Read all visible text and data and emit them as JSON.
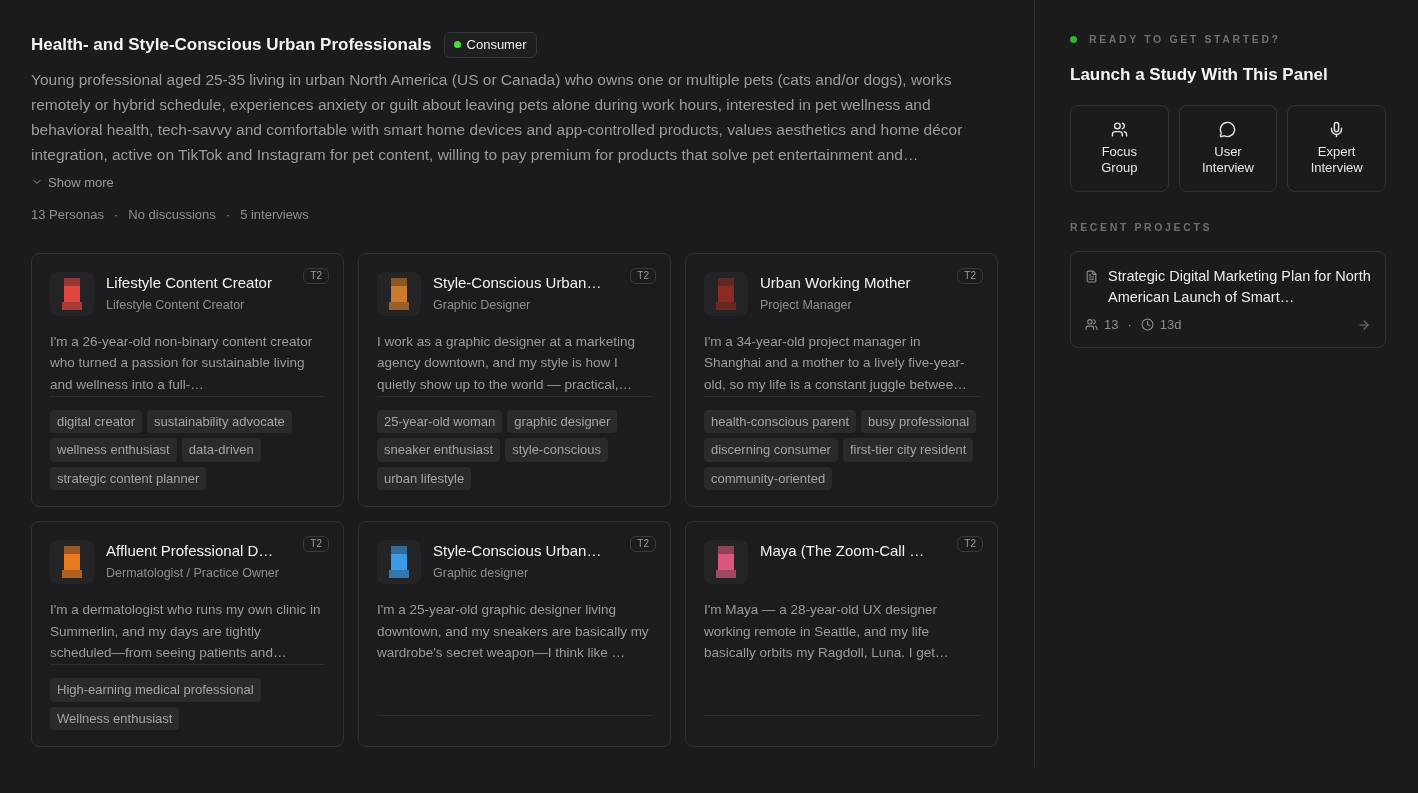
{
  "panel": {
    "title": "Health- and Style-Conscious Urban Professionals",
    "badge": {
      "label": "Consumer",
      "color": "#4ade3a"
    },
    "description": "Young professional aged 25-35 living in urban North America (US or Canada) who owns one or multiple pets (cats and/or dogs), works remotely or hybrid schedule, experiences anxiety or guilt about leaving pets alone during work hours, interested in pet wellness and behavioral health, tech-savvy and comfortable with smart home devices and app-controlled products, values aesthetics and home décor integration, active on TikTok and Instagram for pet content, willing to pay premium for products that solve pet entertainment and…",
    "show_more": "Show more",
    "stats": [
      "13 Personas",
      "No discussions",
      "5 interviews"
    ],
    "separator": "·"
  },
  "personas": [
    {
      "name": "Lifestyle Content Creator",
      "role": "Lifestyle Content Creator",
      "tier": "T2",
      "color": "#e0453f",
      "bio": "I'm a 26-year-old non-binary content creator who turned a passion for sustainable living and wellness into a full-…",
      "tags": [
        "digital creator",
        "sustainability advocate",
        "wellness enthusiast",
        "data-driven",
        "strategic content planner"
      ]
    },
    {
      "name": "Style-Conscious Urban…",
      "role": "Graphic Designer",
      "tier": "T2",
      "color": "#c97a2a",
      "bio": "I work as a graphic designer at a marketing agency downtown, and my style is how I quietly show up to the world — practical,…",
      "tags": [
        "25-year-old woman",
        "graphic designer",
        "sneaker enthusiast",
        "style-conscious",
        "urban lifestyle"
      ]
    },
    {
      "name": "Urban Working Mother",
      "role": "Project Manager",
      "tier": "T2",
      "color": "#8a2a22",
      "bio": "I'm a 34-year-old project manager in Shanghai and a mother to a lively five-year-old, so my life is a constant juggle betwee…",
      "tags": [
        "health-conscious parent",
        "busy professional",
        "discerning consumer",
        "first-tier city resident",
        "community-oriented"
      ]
    },
    {
      "name": "Affluent Professional D…",
      "role": "Dermatologist / Practice Owner",
      "tier": "T2",
      "color": "#ea7a1e",
      "bio": "I'm a dermatologist who runs my own clinic in Summerlin, and my days are tightly scheduled—from seeing patients and…",
      "tags": [
        "High-earning medical professional",
        "Wellness enthusiast"
      ]
    },
    {
      "name": "Style-Conscious Urban…",
      "role": "Graphic designer",
      "tier": "T2",
      "color": "#3b9be8",
      "bio": "I'm a 25-year-old graphic designer living downtown, and my sneakers are basically my wardrobe's secret weapon—I think like …"
    },
    {
      "name": "Maya (The Zoom-Call …",
      "tier": "T2",
      "color": "#d9577a",
      "bio": "I'm Maya — a 28-year-old UX designer working remote in Seattle, and my life basically orbits my Ragdoll, Luna. I get…"
    }
  ],
  "sidebar": {
    "eyebrow": "READY TO GET STARTED?",
    "title": "Launch a Study With This Panel",
    "actions": [
      {
        "kind": "group",
        "label": "Focus Group"
      },
      {
        "kind": "chat",
        "label": "User Interview"
      },
      {
        "kind": "mic",
        "label": "Expert Interview"
      }
    ],
    "recent_heading": "RECENT PROJECTS",
    "projects": [
      {
        "title": "Strategic Digital Marketing Plan for North American Launch of Smart…",
        "people": "13",
        "age": "13d"
      }
    ]
  }
}
